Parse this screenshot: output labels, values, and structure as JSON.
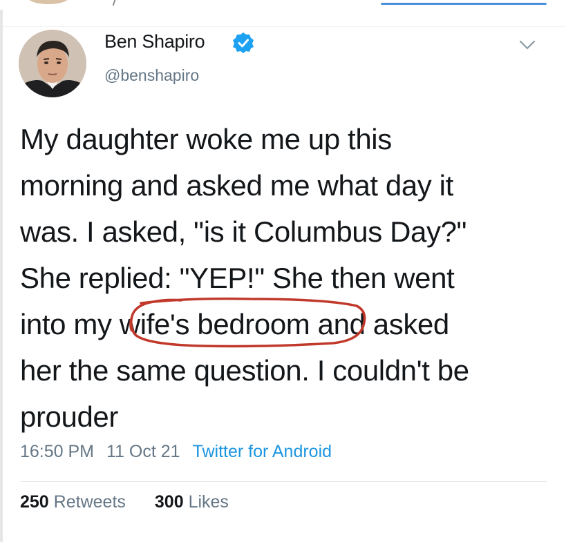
{
  "user": {
    "name": "Ben Shapiro",
    "handle": "@benshapiro",
    "verified": true
  },
  "tweet": {
    "lines": [
      "My daughter woke me up this",
      "morning and asked me what day it",
      "was. I asked, \"is it Columbus Day?\"",
      "She replied: \"YEP!\" She then went"
    ],
    "line5_before": "into my ",
    "line5_circled": "wife's bedroom",
    "line5_after": " and asked",
    "line6": "her the same question. I couldn't be",
    "line7": "prouder"
  },
  "meta": {
    "time": "16:50 PM",
    "date": "11 Oct 21",
    "source": "Twitter for Android"
  },
  "stats": {
    "retweets_count": "250",
    "retweets_label": "Retweets",
    "likes_count": "300",
    "likes_label": "Likes"
  },
  "colors": {
    "text": "#14171a",
    "secondary": "#657786",
    "link": "#1b95e0",
    "verified": "#1da1f2",
    "circle_annotation": "#c0392b"
  },
  "icons": {
    "verified": "verified-badge-icon",
    "chevron": "chevron-down-icon"
  }
}
